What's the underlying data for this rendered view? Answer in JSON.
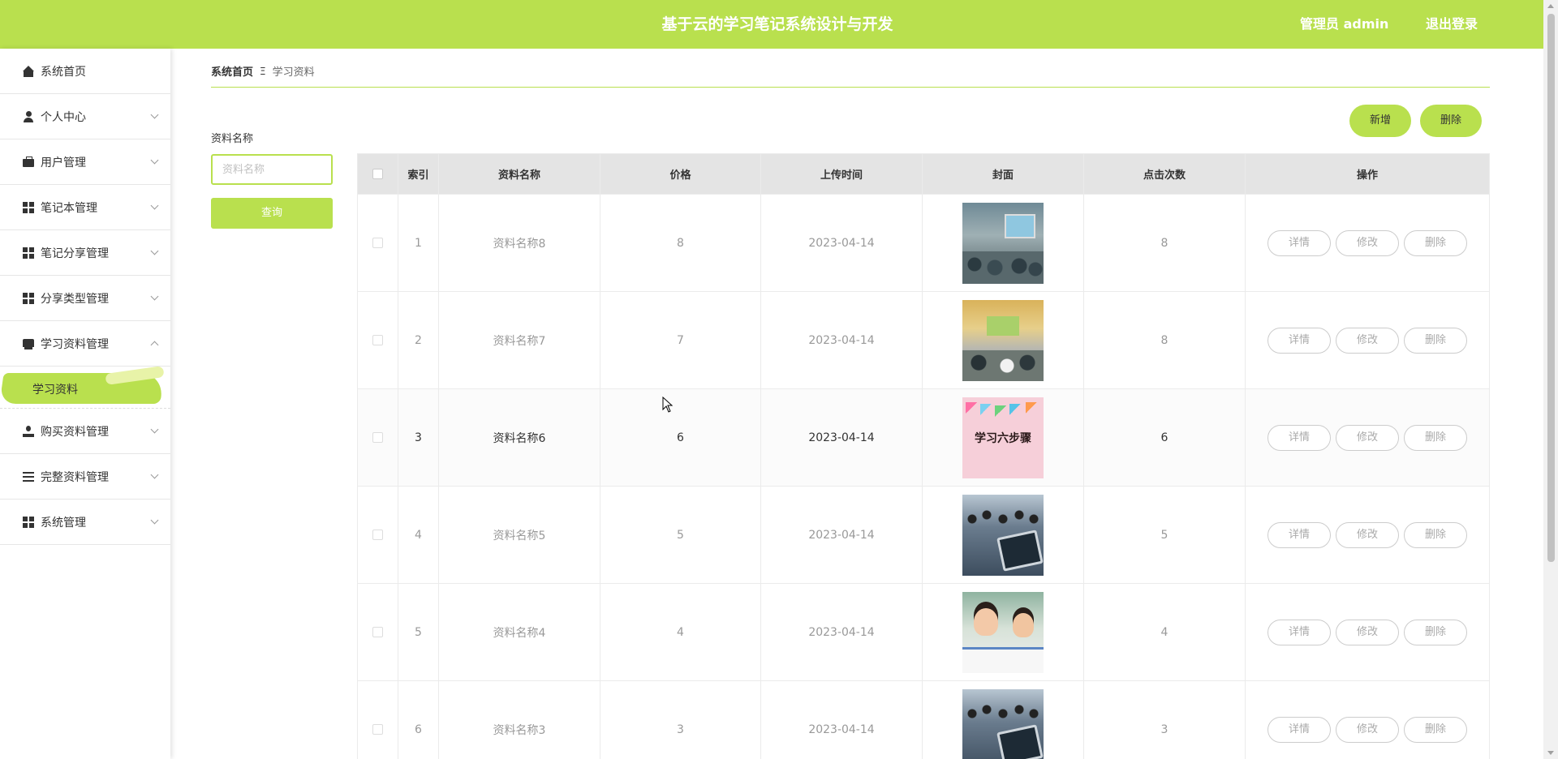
{
  "header": {
    "title": "基于云的学习笔记系统设计与开发",
    "user": "管理员 admin",
    "logout": "退出登录"
  },
  "sidebar": {
    "items": [
      {
        "label": "系统首页",
        "icon": "home-icon"
      },
      {
        "label": "个人中心",
        "icon": "user-icon"
      },
      {
        "label": "用户管理",
        "icon": "briefcase-icon"
      },
      {
        "label": "笔记本管理",
        "icon": "grid-icon"
      },
      {
        "label": "笔记分享管理",
        "icon": "grid-icon"
      },
      {
        "label": "分享类型管理",
        "icon": "grid-icon"
      },
      {
        "label": "学习资料管理",
        "icon": "book-icon"
      },
      {
        "label": "购买资料管理",
        "icon": "user-icon"
      },
      {
        "label": "完整资料管理",
        "icon": "list-icon"
      },
      {
        "label": "系统管理",
        "icon": "grid-icon"
      }
    ],
    "active_sub": "学习资料"
  },
  "breadcrumb": {
    "home": "系统首页",
    "separator": "Ξ",
    "current": "学习资料"
  },
  "search": {
    "label": "资料名称",
    "placeholder": "资料名称",
    "button": "查询"
  },
  "actions": {
    "add": "新增",
    "delete": "删除"
  },
  "table": {
    "columns": [
      "索引",
      "资料名称",
      "价格",
      "上传时间",
      "封面",
      "点击次数",
      "操作"
    ],
    "op_labels": {
      "detail": "详情",
      "edit": "修改",
      "delete": "删除"
    },
    "rows": [
      {
        "index": "1",
        "name": "资料名称8",
        "price": "8",
        "date": "2023-04-14",
        "clicks": "8",
        "cover": "classroom"
      },
      {
        "index": "2",
        "name": "资料名称7",
        "price": "7",
        "date": "2023-04-14",
        "clicks": "8",
        "cover": "lab"
      },
      {
        "index": "3",
        "name": "资料名称6",
        "price": "6",
        "date": "2023-04-14",
        "clicks": "6",
        "cover": "steps",
        "cover_text": "学习六步骤"
      },
      {
        "index": "4",
        "name": "资料名称5",
        "price": "5",
        "date": "2023-04-14",
        "clicks": "5",
        "cover": "tablet"
      },
      {
        "index": "5",
        "name": "资料名称4",
        "price": "4",
        "date": "2023-04-14",
        "clicks": "4",
        "cover": "kids"
      },
      {
        "index": "6",
        "name": "资料名称3",
        "price": "3",
        "date": "2023-04-14",
        "clicks": "3",
        "cover": "tablet"
      }
    ]
  },
  "colors": {
    "accent": "#b9e04e",
    "header_bg": "#b9e04e",
    "table_header_bg": "#e4e4e4"
  }
}
